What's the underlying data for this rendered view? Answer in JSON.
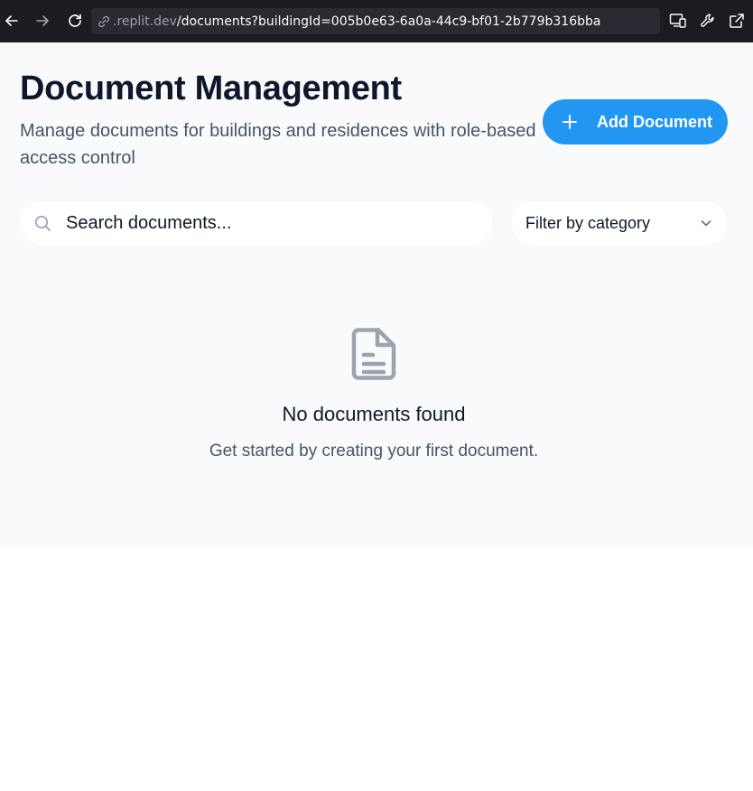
{
  "browser": {
    "url_domain": ".replit.dev",
    "url_path": "/documents?buildingId=005b0e63-6a0a-44c9-bf01-2b779b316bba"
  },
  "header": {
    "title": "Document Management",
    "subtitle": "Manage documents for buildings and residences with role-based access control",
    "add_button_label": "Add Document"
  },
  "filters": {
    "search_placeholder": "Search documents...",
    "category_value": "Filter by category"
  },
  "empty_state": {
    "title": "No documents found",
    "message": "Get started by creating your first document."
  },
  "colors": {
    "accent": "#2196f3",
    "page_background": "#f8fafc",
    "browser_chrome": "#1c1b22"
  },
  "icons": {
    "back": "arrow-left-icon",
    "forward": "arrow-right-icon",
    "reload": "reload-icon",
    "url": "link-icon",
    "responsive": "responsive-design-icon",
    "tools": "wrench-icon",
    "open_external": "external-link-icon",
    "add": "plus-icon",
    "search": "search-icon",
    "dropdown": "chevron-down-icon",
    "empty": "file-text-icon"
  }
}
